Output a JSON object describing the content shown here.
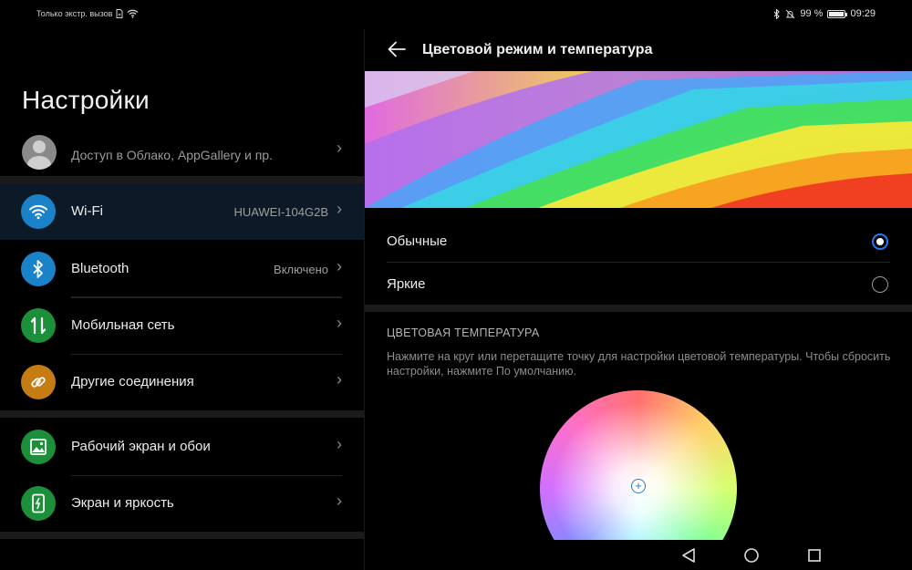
{
  "status_bar": {
    "carrier": "Только экстр. вызов",
    "battery_percent": "99 %",
    "time": "09:29",
    "battery_level": 0.99
  },
  "settings": {
    "title": "Настройки",
    "account_subtitle": "Доступ в Облако, AppGallery и пр.",
    "items": [
      {
        "label": "Wi-Fi",
        "value": "HUAWEI-104G2B",
        "icon": "wifi-icon",
        "color": "#1a82c9"
      },
      {
        "label": "Bluetooth",
        "value": "Включено",
        "icon": "bluetooth-icon",
        "color": "#1a82c9"
      },
      {
        "label": "Мобильная сеть",
        "value": "",
        "icon": "mobile-data-icon",
        "color": "#1c8f3a"
      },
      {
        "label": "Другие соединения",
        "value": "",
        "icon": "link-icon",
        "color": "#c57c12"
      },
      {
        "label": "Рабочий экран и обои",
        "value": "",
        "icon": "wallpaper-icon",
        "color": "#1c8f3a"
      },
      {
        "label": "Экран и яркость",
        "value": "",
        "icon": "display-icon",
        "color": "#1c8f3a"
      }
    ]
  },
  "detail": {
    "title": "Цветовой режим и температура",
    "modes": [
      {
        "label": "Обычные",
        "selected": true
      },
      {
        "label": "Яркие",
        "selected": false
      }
    ],
    "section_title": "ЦВЕТОВАЯ ТЕМПЕРАТУРА",
    "description": "Нажмите на круг или перетащите точку для настройки цветовой температуры. Чтобы сбросить настройки, нажмите По умолчанию."
  },
  "colors": {
    "accent": "#1e7cf2",
    "selected_row_bg": "#0b1a26"
  }
}
